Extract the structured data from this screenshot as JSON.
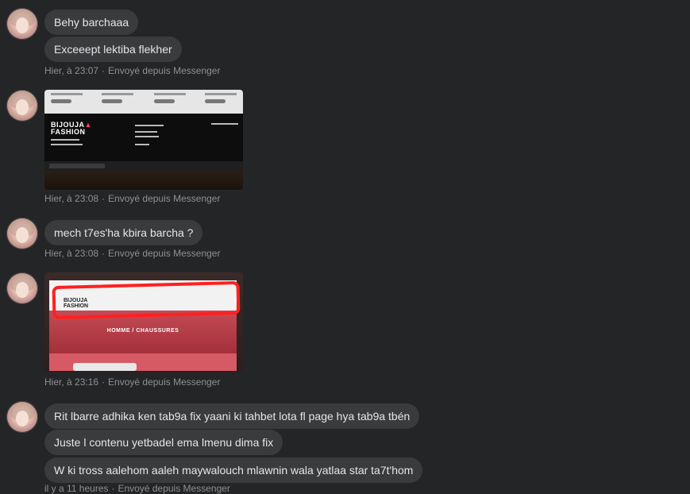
{
  "messages": [
    {
      "text": "Behy barchaaa"
    },
    {
      "text": "Exceeept lektiba flekher"
    },
    {
      "text": "mech t7es'ha kbira barcha ?"
    },
    {
      "text": "Rit lbarre adhika ken tab9a fix yaani ki tahbet lota fl page hya tab9a tbén"
    },
    {
      "text": "Juste l contenu yetbadel ema lmenu dima fix"
    },
    {
      "text": "W ki tross aalehom aaleh maywalouch mlawnin wala yatlaa star ta7t'hom"
    }
  ],
  "meta": [
    {
      "time": "Hier, à 23:07",
      "source": "Envoyé depuis Messenger"
    },
    {
      "time": "Hier, à 23:08",
      "source": "Envoyé depuis Messenger"
    },
    {
      "time": "Hier, à 23:08",
      "source": "Envoyé depuis Messenger"
    },
    {
      "time": "Hier, à 23:16",
      "source": "Envoyé depuis Messenger"
    },
    {
      "time": "il y a 11 heures",
      "source": "Envoyé depuis Messenger"
    }
  ],
  "separator": "·",
  "images": [
    {
      "brand_line1": "BIJOUJA",
      "brand_accent": "▲",
      "brand_line2": "FASHION"
    },
    {
      "brand_line1": "BIJOUJA",
      "brand_line2": "FASHION",
      "banner_text": "HOMME / CHAUSSURES"
    }
  ],
  "colors": {
    "background": "#242526",
    "bubble": "#3a3b3c",
    "text": "#e4e6eb",
    "meta": "#8e9094"
  }
}
